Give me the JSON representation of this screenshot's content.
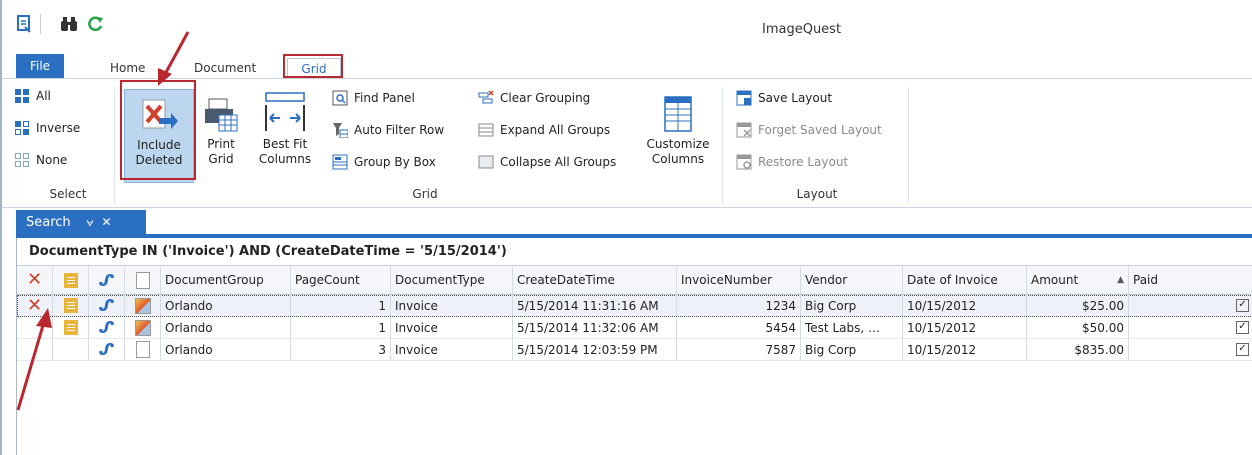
{
  "app": {
    "title": "ImageQuest"
  },
  "ribbon_tabs": [
    "File",
    "Home",
    "Document",
    "Grid"
  ],
  "ribbon": {
    "select_group": {
      "label": "Select",
      "items": [
        "All",
        "Inverse",
        "None"
      ]
    },
    "grid_group": {
      "label": "Grid",
      "include_deleted": [
        "Include",
        "Deleted"
      ],
      "print_grid": [
        "Print",
        "Grid"
      ],
      "best_fit": [
        "Best Fit",
        "Columns"
      ],
      "find_panel": "Find Panel",
      "auto_filter_row": "Auto Filter Row",
      "group_by_box": "Group By Box",
      "clear_grouping": "Clear Grouping",
      "expand_all": "Expand All Groups",
      "collapse_all": "Collapse All Groups",
      "customize": [
        "Customize",
        "Columns"
      ]
    },
    "layout_group": {
      "label": "Layout",
      "save": "Save Layout",
      "forget": "Forget Saved Layout",
      "restore": "Restore Layout"
    }
  },
  "doc_tab": {
    "label": "Search",
    "pin": "⩝",
    "close": "✕"
  },
  "filter_text": "DocumentType IN ('Invoice') AND (CreateDateTime = '5/15/2014')",
  "columns": [
    "DocumentGroup",
    "PageCount",
    "DocumentType",
    "CreateDateTime",
    "InvoiceNumber",
    "Vendor",
    "Date of Invoice",
    "Amount",
    "Paid"
  ],
  "sort_indicator": "▲",
  "rows": [
    {
      "deleted": true,
      "note": true,
      "thumb": "image",
      "group": "Orlando",
      "pages": "1",
      "type": "Invoice",
      "created": "5/15/2014 11:31:16 AM",
      "invoice": "1234",
      "vendor": "Big Corp",
      "date": "10/15/2012",
      "amount": "$25.00"
    },
    {
      "deleted": false,
      "note": true,
      "thumb": "image",
      "group": "Orlando",
      "pages": "1",
      "type": "Invoice",
      "created": "5/15/2014 11:32:06 AM",
      "invoice": "5454",
      "vendor": "Test Labs, …",
      "date": "10/15/2012",
      "amount": "$50.00"
    },
    {
      "deleted": false,
      "note": false,
      "thumb": "blank",
      "group": "Orlando",
      "pages": "3",
      "type": "Invoice",
      "created": "5/15/2014 12:03:59 PM",
      "invoice": "7587",
      "vendor": "Big Corp",
      "date": "10/15/2012",
      "amount": "$835.00"
    }
  ],
  "colors": {
    "accent": "#2b6fc2",
    "highlight": "#b8282e",
    "selected_button": "#bcd6ef",
    "delete_mark": "#d0402b"
  }
}
